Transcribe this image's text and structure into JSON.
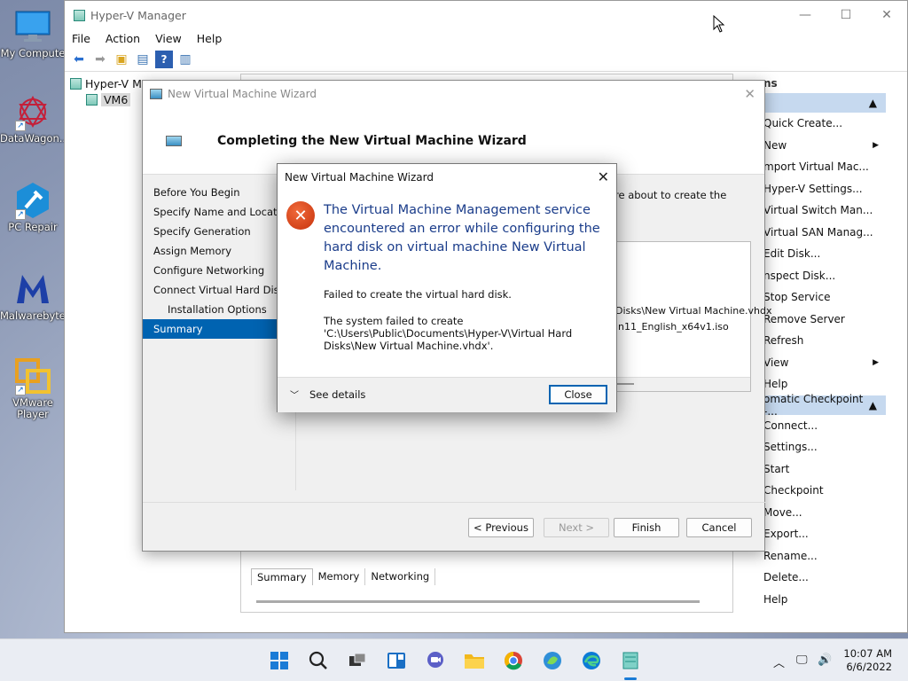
{
  "desktop": {
    "icons": [
      {
        "label": "My Compute",
        "icon": "monitor-icon"
      },
      {
        "label": "DataWagon...",
        "icon": "datawagon-icon"
      },
      {
        "label": "PC Repair",
        "icon": "pc-repair-icon"
      },
      {
        "label": "Malwarebytes",
        "icon": "malwarebytes-icon"
      },
      {
        "label": "VMware Player",
        "icon": "vmware-icon"
      }
    ]
  },
  "hyperv": {
    "title": "Hyper-V Manager",
    "menu": [
      "File",
      "Action",
      "View",
      "Help"
    ],
    "tree": {
      "root": "Hyper-V Ma",
      "child": "VM6"
    },
    "lower_tabs": [
      "Summary",
      "Memory",
      "Networking"
    ],
    "actions": {
      "header": "ns",
      "section1": "",
      "items1": [
        {
          "label": "Quick Create...",
          "arrow": false
        },
        {
          "label": "New",
          "arrow": true
        },
        {
          "label": "mport Virtual Mac...",
          "arrow": false
        },
        {
          "label": "Hyper-V Settings...",
          "arrow": false
        },
        {
          "label": "Virtual Switch Man...",
          "arrow": false
        },
        {
          "label": "Virtual SAN Manag...",
          "arrow": false
        },
        {
          "label": "Edit Disk...",
          "arrow": false
        },
        {
          "label": "nspect Disk...",
          "arrow": false
        },
        {
          "label": "Stop Service",
          "arrow": false
        },
        {
          "label": "Remove Server",
          "arrow": false
        },
        {
          "label": "Refresh",
          "arrow": false
        },
        {
          "label": "View",
          "arrow": true
        },
        {
          "label": "Help",
          "arrow": false
        }
      ],
      "section2": "omatic Checkpoint -...",
      "items2": [
        {
          "label": "Connect...",
          "arrow": false
        },
        {
          "label": "Settings...",
          "arrow": false
        },
        {
          "label": "Start",
          "arrow": false
        },
        {
          "label": "Checkpoint",
          "arrow": false
        },
        {
          "label": "Move...",
          "arrow": false
        },
        {
          "label": "Export...",
          "arrow": false
        },
        {
          "label": "Rename...",
          "arrow": false
        },
        {
          "label": "Delete...",
          "arrow": false
        },
        {
          "label": "Help",
          "arrow": false
        }
      ]
    }
  },
  "wizard": {
    "title": "New Virtual Machine Wizard",
    "heading": "Completing the New Virtual Machine Wizard",
    "steps": [
      {
        "label": "Before You Begin",
        "sub": false,
        "selected": false
      },
      {
        "label": "Specify Name and Location",
        "sub": false,
        "selected": false
      },
      {
        "label": "Specify Generation",
        "sub": false,
        "selected": false
      },
      {
        "label": "Assign Memory",
        "sub": false,
        "selected": false
      },
      {
        "label": "Configure Networking",
        "sub": false,
        "selected": false
      },
      {
        "label": "Connect Virtual Hard Disk",
        "sub": false,
        "selected": false
      },
      {
        "label": "Installation Options",
        "sub": true,
        "selected": false
      },
      {
        "label": "Summary",
        "sub": false,
        "selected": true
      }
    ],
    "intro_fragment": "re about to create the",
    "summary_fragment1": "Disks\\New Virtual Machine.vhdx",
    "summary_fragment2": "in11_English_x64v1.iso",
    "buttons": {
      "previous": "< Previous",
      "next": "Next >",
      "finish": "Finish",
      "cancel": "Cancel"
    }
  },
  "error_dialog": {
    "title": "New Virtual Machine Wizard",
    "main": "The Virtual Machine Management service encountered an error while configuring the hard disk on virtual machine New Virtual Machine.",
    "sub": "Failed to create the virtual hard disk.",
    "detail": "The system failed to create 'C:\\Users\\Public\\Documents\\Hyper-V\\Virtual Hard Disks\\New Virtual Machine.vhdx'.",
    "see_details": "See details",
    "close": "Close"
  },
  "taskbar": {
    "time": "10:07 AM",
    "date": "6/6/2022",
    "apps": [
      "start-icon",
      "search-icon",
      "task-view-icon",
      "widgets-icon",
      "chat-icon",
      "file-explorer-icon",
      "chrome-icon",
      "app-icon",
      "edge-icon",
      "hyperv-manager-icon"
    ]
  }
}
